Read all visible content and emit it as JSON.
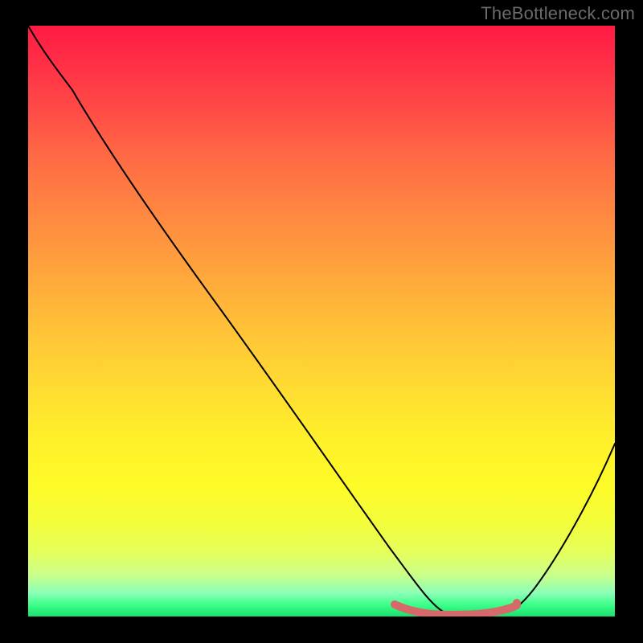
{
  "watermark": "TheBottleneck.com",
  "chart_data": {
    "type": "line",
    "title": "",
    "xlabel": "",
    "ylabel": "",
    "xlim": [
      0,
      100
    ],
    "ylim": [
      0,
      100
    ],
    "grid": false,
    "legend": false,
    "background_gradient": {
      "top": "#ff1a43",
      "middle": "#ffe030",
      "bottom": "#17e06e"
    },
    "series": [
      {
        "name": "bottleneck-curve",
        "color": "#000000",
        "x": [
          0,
          3,
          7,
          12,
          18,
          25,
          32,
          40,
          48,
          55,
          61,
          65,
          68,
          71,
          74,
          77,
          80,
          83,
          88,
          94,
          100
        ],
        "y": [
          100,
          96,
          92,
          86,
          79,
          70,
          61,
          51,
          40,
          30,
          20,
          12,
          6,
          2,
          0,
          0,
          0,
          2,
          8,
          20,
          38
        ]
      },
      {
        "name": "optimal-range-highlight",
        "color": "#d66a6a",
        "x": [
          62,
          65,
          68,
          71,
          74,
          77,
          80,
          83
        ],
        "y": [
          1.5,
          1,
          0,
          0,
          0,
          0,
          0,
          1.5
        ]
      }
    ]
  }
}
